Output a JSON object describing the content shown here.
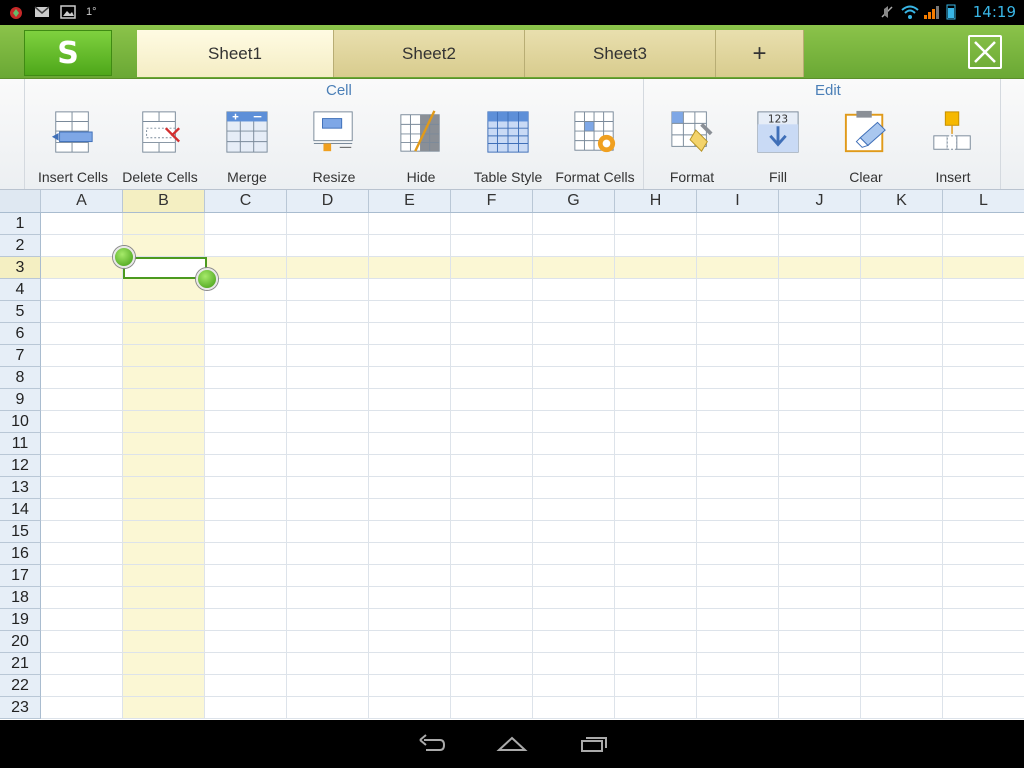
{
  "status_bar": {
    "time": "14:19",
    "notification_text": "1°",
    "icons": [
      "app-notification-icon",
      "gmail-icon",
      "gallery-icon",
      "mute-icon",
      "wifi-icon",
      "signal-icon",
      "battery-icon"
    ]
  },
  "app": {
    "logo_letter": "S",
    "tabs": [
      {
        "label": "Sheet1",
        "active": true
      },
      {
        "label": "Sheet2",
        "active": false
      },
      {
        "label": "Sheet3",
        "active": false
      },
      {
        "label": "+",
        "active": false
      }
    ],
    "close_icon": "close-icon"
  },
  "ribbon": {
    "groups": [
      {
        "title": "Cell",
        "buttons": [
          "Insert Cells",
          "Delete Cells",
          "Merge",
          "Resize",
          "Hide",
          "Table Style",
          "Format Cells"
        ]
      },
      {
        "title": "Edit",
        "buttons": [
          "Format",
          "Fill",
          "Clear",
          "Insert"
        ]
      }
    ],
    "fill_icon_text": "123"
  },
  "sheet": {
    "columns": [
      "A",
      "B",
      "C",
      "D",
      "E",
      "F",
      "G",
      "H",
      "I",
      "J",
      "K",
      "L"
    ],
    "rows": [
      "1",
      "2",
      "3",
      "4",
      "5",
      "6",
      "7",
      "8",
      "9",
      "10",
      "11",
      "12",
      "13",
      "14",
      "15",
      "16",
      "17",
      "18",
      "19",
      "20",
      "21",
      "22",
      "23"
    ],
    "selected_cell": "B3",
    "selected_column": "B",
    "selected_row": "3",
    "accent_color": "#4c9a1f",
    "selection_tint": "#fbf7d4"
  },
  "nav_bar": {
    "buttons": [
      "back-icon",
      "home-icon",
      "recent-apps-icon"
    ]
  }
}
